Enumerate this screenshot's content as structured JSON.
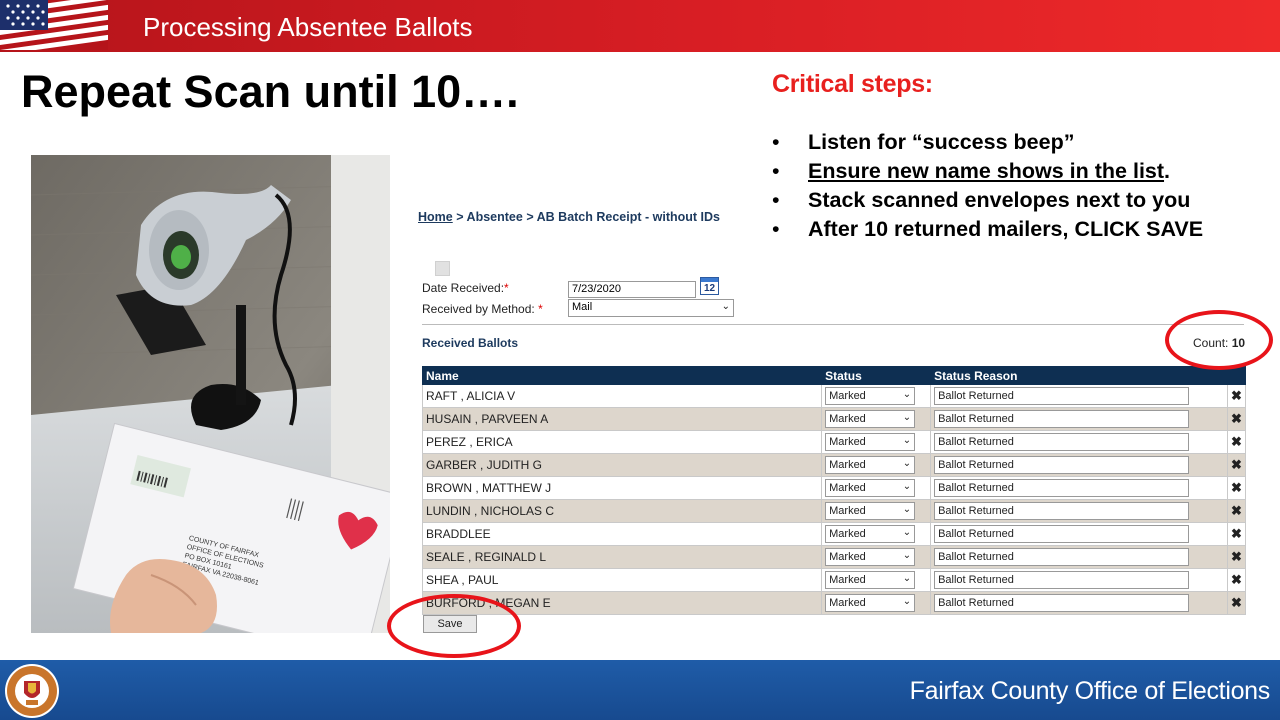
{
  "header": {
    "title": "Processing Absentee Ballots"
  },
  "slide": {
    "title": "Repeat Scan until 10….",
    "critical_title": "Critical steps:",
    "steps": [
      "Listen for “success beep”",
      "Ensure new name shows in the list",
      "Stack scanned envelopes next to you",
      "After 10 returned mailers, CLICK SAVE"
    ],
    "step2_suffix": "."
  },
  "ui": {
    "breadcrumb": {
      "home": "Home",
      "sep1": ">",
      "absentee": "Absentee",
      "sep2": ">",
      "current": "AB Batch Receipt - without IDs"
    },
    "date_label": "Date Received:",
    "date_req": "*",
    "date_value": "7/23/2020",
    "calendar_icon_text": "12",
    "method_label": "Received by Method:",
    "method_req": "*",
    "method_value": "Mail",
    "received_title": "Received Ballots",
    "count_label": "Count:",
    "count_value": "10",
    "columns": [
      "Name",
      "Status",
      "Status Reason"
    ],
    "rows": [
      {
        "name": "RAFT , ALICIA V",
        "status": "Marked",
        "reason": "Ballot Returned"
      },
      {
        "name": "HUSAIN , PARVEEN A",
        "status": "Marked",
        "reason": "Ballot Returned"
      },
      {
        "name": "PEREZ , ERICA",
        "status": "Marked",
        "reason": "Ballot Returned"
      },
      {
        "name": "GARBER , JUDITH G",
        "status": "Marked",
        "reason": "Ballot Returned"
      },
      {
        "name": "BROWN , MATTHEW J",
        "status": "Marked",
        "reason": "Ballot Returned"
      },
      {
        "name": "LUNDIN , NICHOLAS C",
        "status": "Marked",
        "reason": "Ballot Returned"
      },
      {
        "name": "BRADDLEE",
        "status": "Marked",
        "reason": "Ballot Returned"
      },
      {
        "name": "SEALE , REGINALD L",
        "status": "Marked",
        "reason": "Ballot Returned"
      },
      {
        "name": "SHEA , PAUL",
        "status": "Marked",
        "reason": "Ballot Returned"
      },
      {
        "name": "BURFORD , MEGAN E",
        "status": "Marked",
        "reason": "Ballot Returned"
      }
    ],
    "delete_glyph": "✖",
    "save_label": "Save"
  },
  "footer": {
    "org": "Fairfax County Office of Elections"
  },
  "photo": {
    "envelope_lines": [
      "COUNTY OF FAIRFAX",
      "OFFICE OF ELECTIONS",
      "PO BOX 10161",
      "FAIRFAX VA 22038-8061"
    ]
  },
  "colors": {
    "header_red": "#d81e24",
    "critical_red": "#e8201e",
    "table_header": "#0e2f52",
    "row_alt": "#ddd6cc",
    "footer_blue": "#1f5ca8",
    "ring_red": "#e8141a"
  }
}
